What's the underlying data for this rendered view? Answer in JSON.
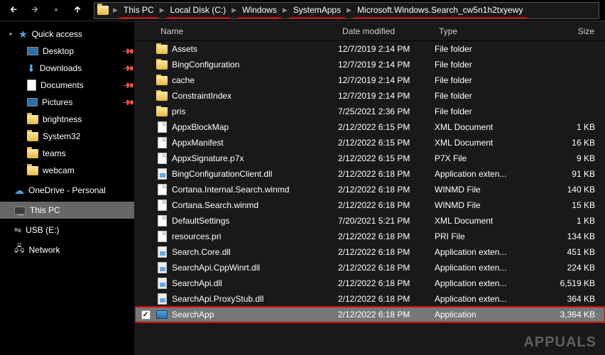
{
  "breadcrumb": [
    {
      "label": "This PC",
      "underline": true
    },
    {
      "label": "Local Disk (C:)",
      "underline": true
    },
    {
      "label": "Windows",
      "underline": true
    },
    {
      "label": "SystemApps",
      "underline": true
    },
    {
      "label": "Microsoft.Windows.Search_cw5n1h2txyewy",
      "underline": true
    }
  ],
  "columns": {
    "name": "Name",
    "date": "Date modified",
    "type": "Type",
    "size": "Size"
  },
  "sidebar": {
    "quick": {
      "label": "Quick access",
      "items": [
        {
          "label": "Desktop",
          "icon": "desktop",
          "pinned": true
        },
        {
          "label": "Downloads",
          "icon": "downloads",
          "pinned": true
        },
        {
          "label": "Documents",
          "icon": "documents",
          "pinned": true
        },
        {
          "label": "Pictures",
          "icon": "pictures",
          "pinned": true
        },
        {
          "label": "brightness",
          "icon": "folder",
          "pinned": false
        },
        {
          "label": "System32",
          "icon": "folder",
          "pinned": false
        },
        {
          "label": "teams",
          "icon": "folder",
          "pinned": false
        },
        {
          "label": "webcam",
          "icon": "folder",
          "pinned": false
        }
      ]
    },
    "onedrive": {
      "label": "OneDrive - Personal"
    },
    "thispc": {
      "label": "This PC",
      "selected": true
    },
    "usb": {
      "label": "USB (E:)"
    },
    "network": {
      "label": "Network"
    }
  },
  "files": [
    {
      "name": "Assets",
      "date": "12/7/2019 2:14 PM",
      "type": "File folder",
      "size": "",
      "icon": "folder"
    },
    {
      "name": "BingConfiguration",
      "date": "12/7/2019 2:14 PM",
      "type": "File folder",
      "size": "",
      "icon": "folder"
    },
    {
      "name": "cache",
      "date": "12/7/2019 2:14 PM",
      "type": "File folder",
      "size": "",
      "icon": "folder"
    },
    {
      "name": "ConstraintIndex",
      "date": "12/7/2019 2:14 PM",
      "type": "File folder",
      "size": "",
      "icon": "folder"
    },
    {
      "name": "pris",
      "date": "7/25/2021 2:36 PM",
      "type": "File folder",
      "size": "",
      "icon": "folder"
    },
    {
      "name": "AppxBlockMap",
      "date": "2/12/2022 6:15 PM",
      "type": "XML Document",
      "size": "1 KB",
      "icon": "file"
    },
    {
      "name": "AppxManifest",
      "date": "2/12/2022 6:15 PM",
      "type": "XML Document",
      "size": "16 KB",
      "icon": "file"
    },
    {
      "name": "AppxSignature.p7x",
      "date": "2/12/2022 6:15 PM",
      "type": "P7X File",
      "size": "9 KB",
      "icon": "file"
    },
    {
      "name": "BingConfigurationClient.dll",
      "date": "2/12/2022 6:18 PM",
      "type": "Application exten...",
      "size": "91 KB",
      "icon": "dll"
    },
    {
      "name": "Cortana.Internal.Search.winmd",
      "date": "2/12/2022 6:18 PM",
      "type": "WINMD File",
      "size": "140 KB",
      "icon": "file"
    },
    {
      "name": "Cortana.Search.winmd",
      "date": "2/12/2022 6:18 PM",
      "type": "WINMD File",
      "size": "15 KB",
      "icon": "file"
    },
    {
      "name": "DefaultSettings",
      "date": "7/20/2021 5:21 PM",
      "type": "XML Document",
      "size": "1 KB",
      "icon": "file"
    },
    {
      "name": "resources.pri",
      "date": "2/12/2022 6:18 PM",
      "type": "PRI File",
      "size": "134 KB",
      "icon": "file"
    },
    {
      "name": "Search.Core.dll",
      "date": "2/12/2022 6:18 PM",
      "type": "Application exten...",
      "size": "451 KB",
      "icon": "dll"
    },
    {
      "name": "SearchApi.CppWinrt.dll",
      "date": "2/12/2022 6:18 PM",
      "type": "Application exten...",
      "size": "224 KB",
      "icon": "dll"
    },
    {
      "name": "SearchApi.dll",
      "date": "2/12/2022 6:18 PM",
      "type": "Application exten...",
      "size": "6,519 KB",
      "icon": "dll"
    },
    {
      "name": "SearchApi.ProxyStub.dll",
      "date": "2/12/2022 6:18 PM",
      "type": "Application exten...",
      "size": "364 KB",
      "icon": "dll"
    },
    {
      "name": "SearchApp",
      "date": "2/12/2022 6:18 PM",
      "type": "Application",
      "size": "3,364 KB",
      "icon": "app",
      "selected": true,
      "checked": true,
      "highlight": true
    }
  ],
  "watermark": "APPUALS"
}
